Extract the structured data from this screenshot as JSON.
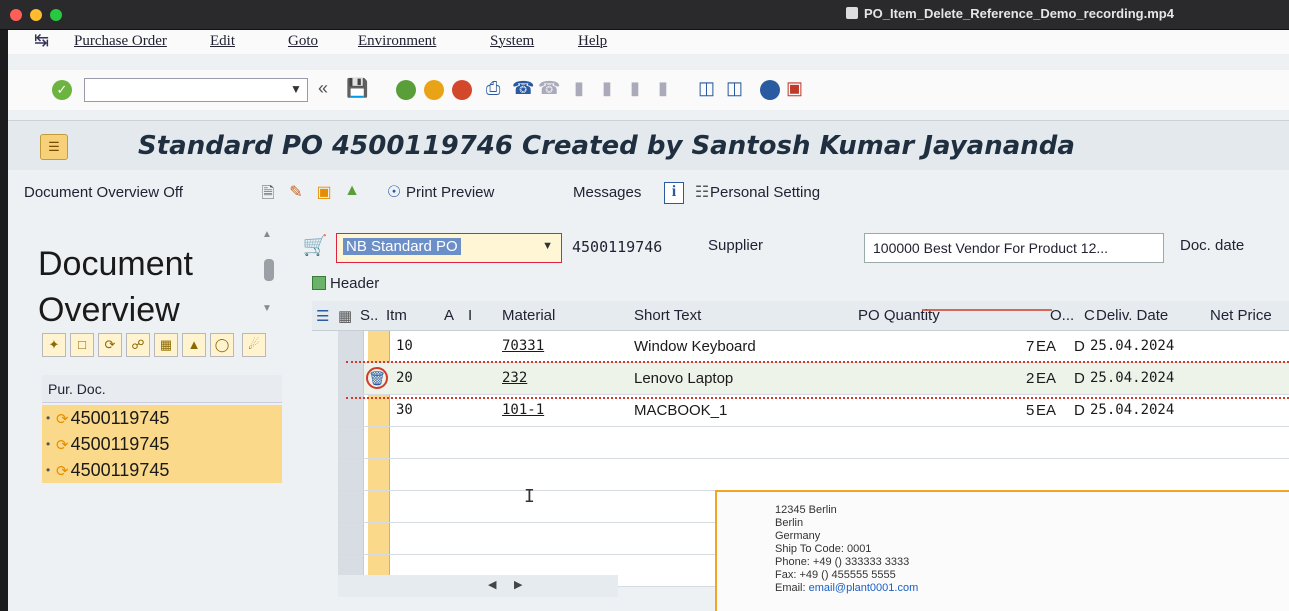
{
  "window": {
    "video_title": "PO_Item_Delete_Reference_Demo_recording.mp4"
  },
  "menu": {
    "items": [
      "Purchase Order",
      "Edit",
      "Goto",
      "Environment",
      "System",
      "Help"
    ]
  },
  "title": "Standard PO 4500119746 Created by Santosh Kumar Jayananda",
  "app_toolbar": {
    "doc_overview_off": "Document Overview Off",
    "print_preview": "Print Preview",
    "messages": "Messages",
    "personal_setting": "Personal Setting"
  },
  "left_pane": {
    "title_line1": "Document",
    "title_line2": "Overview",
    "column_header": "Pur. Doc.",
    "docs": [
      "4500119745",
      "4500119745",
      "4500119745"
    ]
  },
  "header": {
    "doc_type": "NB Standard PO",
    "po_number": "4500119746",
    "supplier_label": "Supplier",
    "supplier_value": "100000 Best Vendor For Product 12...",
    "doc_date_label": "Doc. date",
    "header_label": "Header"
  },
  "grid": {
    "columns": [
      "S..",
      "Itm",
      "A",
      "I",
      "Material",
      "Short Text",
      "PO Quantity",
      "O...",
      "C",
      "Deliv. Date",
      "Net Price"
    ],
    "rows": [
      {
        "item": "10",
        "material": "70331",
        "short_text": "Window Keyboard",
        "qty": "7",
        "unit": "EA",
        "cat": "D",
        "date": "25.04.2024"
      },
      {
        "item": "20",
        "material": "232",
        "short_text": "Lenovo Laptop",
        "qty": "2",
        "unit": "EA",
        "cat": "D",
        "date": "25.04.2024"
      },
      {
        "item": "30",
        "material": "101-1",
        "short_text": "MACBOOK_1",
        "qty": "5",
        "unit": "EA",
        "cat": "D",
        "date": "25.04.2024"
      }
    ]
  },
  "popup": {
    "lines": [
      "12345 Berlin",
      "Berlin",
      "Germany",
      "Ship To Code:  0001",
      "Phone:  +49 () 333333 3333",
      "Fax:  +49 () 455555 5555"
    ],
    "email_label": "Email: ",
    "email": "email@plant0001.com"
  },
  "colors": {
    "accent_orange": "#f2a524",
    "highlight_yellow": "#fbd98a",
    "annotation_red": "#d23a2a"
  }
}
